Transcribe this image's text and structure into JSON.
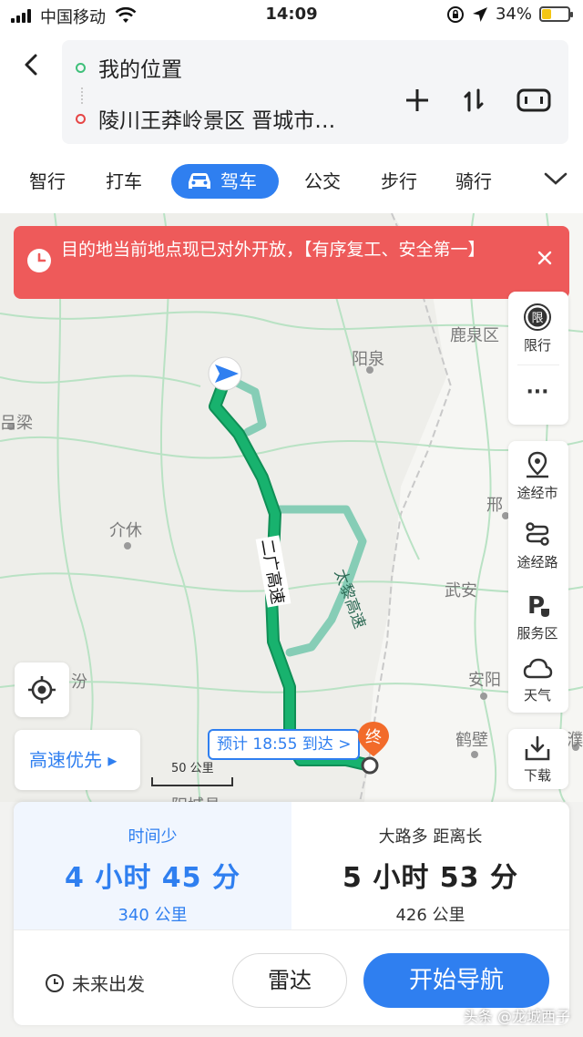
{
  "status_bar": {
    "carrier": "中国移动",
    "time": "14:09",
    "battery": "34%",
    "battery_level": 0.34
  },
  "route": {
    "start": "我的位置",
    "end": "陵川王莽岭景区 晋城市…"
  },
  "modes": [
    "智行",
    "打车",
    "驾车",
    "公交",
    "步行",
    "骑行"
  ],
  "active_mode": "驾车",
  "alert": {
    "text": "目的地当前地点现已对外开放，【有序复工、安全第一】"
  },
  "map": {
    "places": [
      "鹿泉区",
      "阳泉",
      "吕梁",
      "介休",
      "邢",
      "武安",
      "安阳",
      "鹤壁",
      "汾",
      "濮",
      "阳城县"
    ],
    "road_labels": [
      "二广高速",
      "太黎高速"
    ],
    "eta_label": "预计 18:55 到达 >",
    "end_marker": "终",
    "scale_label": "50 公里",
    "highway_pref": "高速优先 ▸"
  },
  "side_tools": {
    "restrict": "限行",
    "restrict_icon": "限",
    "more": "···",
    "via_city": "途经市",
    "via_road": "途经路",
    "service_area": "服务区",
    "weather": "天气",
    "download": "下载"
  },
  "options": [
    {
      "tag": "时间少",
      "duration": "4 小时 45 分",
      "distance": "340 公里"
    },
    {
      "tag": "大路多  距离长",
      "duration": "5 小时 53 分",
      "distance": "426 公里"
    }
  ],
  "actions": {
    "future": "未来出发",
    "radar": "雷达",
    "navigate": "开始导航"
  },
  "watermark": "头条 @龙城西子",
  "colors": {
    "accent": "#2f7ff0",
    "route_primary": "#18b26e",
    "route_alt": "#86cdb6",
    "alert": "#ee5a5a",
    "end_pin": "#f26b2a"
  }
}
